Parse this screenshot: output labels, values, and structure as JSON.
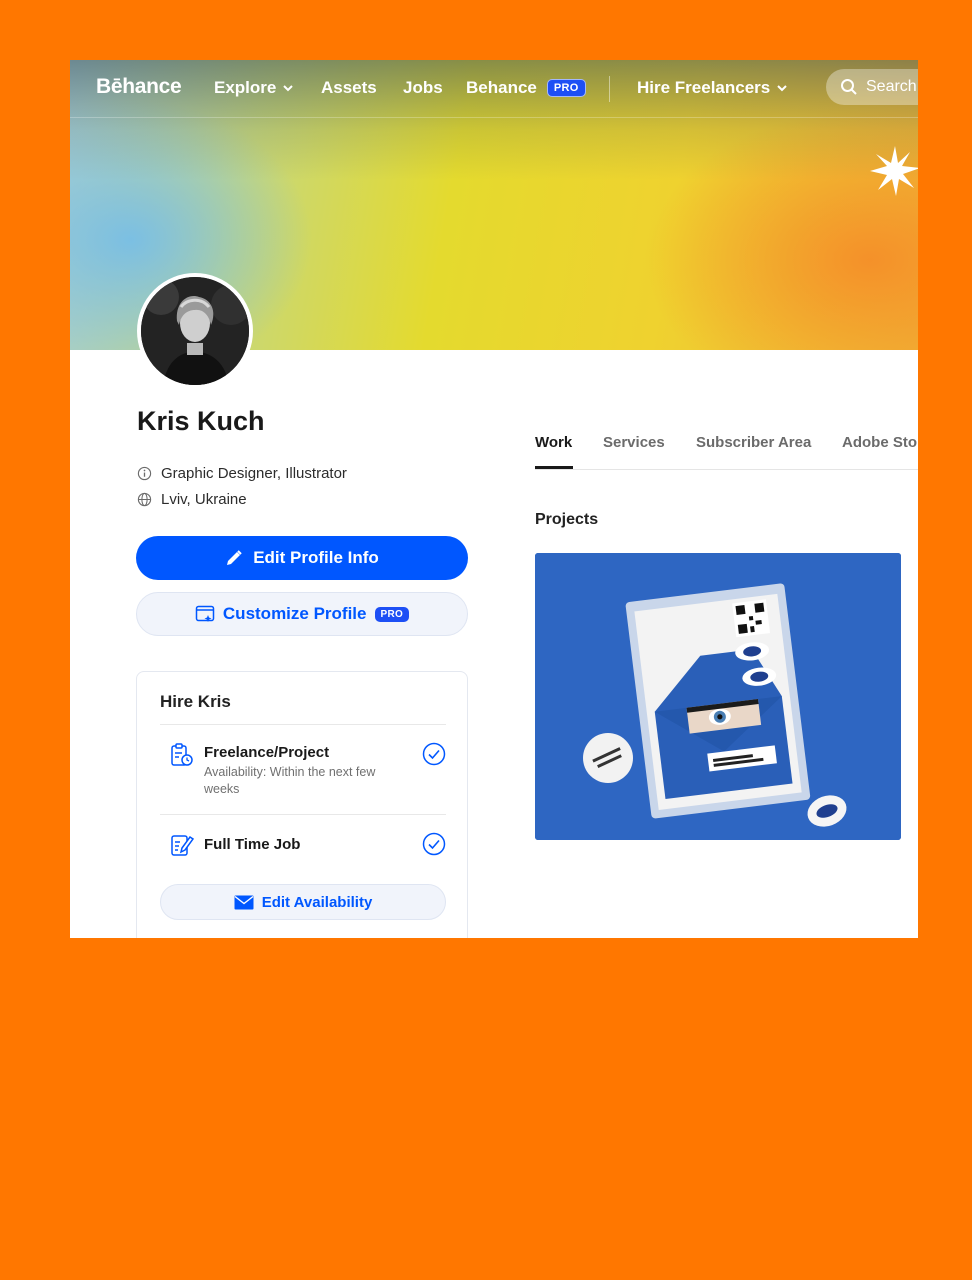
{
  "nav": {
    "logo": "Bēhance",
    "explore": "Explore",
    "assets": "Assets",
    "jobs": "Jobs",
    "behance": "Behance",
    "pro_badge": "PRO",
    "hire": "Hire Freelancers",
    "search_placeholder": "Search"
  },
  "profile": {
    "name": "Kris Kuch",
    "occupation": "Graphic Designer, Illustrator",
    "location": "Lviv, Ukraine",
    "edit_button": "Edit Profile Info",
    "customize_button": "Customize Profile",
    "customize_badge": "PRO"
  },
  "hire": {
    "title": "Hire Kris",
    "options": [
      {
        "title": "Freelance/Project",
        "subtitle": "Availability: Within the next few weeks"
      },
      {
        "title": "Full Time Job"
      }
    ],
    "edit_availability": "Edit Availability"
  },
  "tabs": [
    "Work",
    "Services",
    "Subscriber Area",
    "Adobe Sto"
  ],
  "projects": {
    "title": "Projects"
  },
  "colors": {
    "background": "#ff7700",
    "accent": "#0057ff",
    "pro_badge": "#1d4ff5"
  }
}
